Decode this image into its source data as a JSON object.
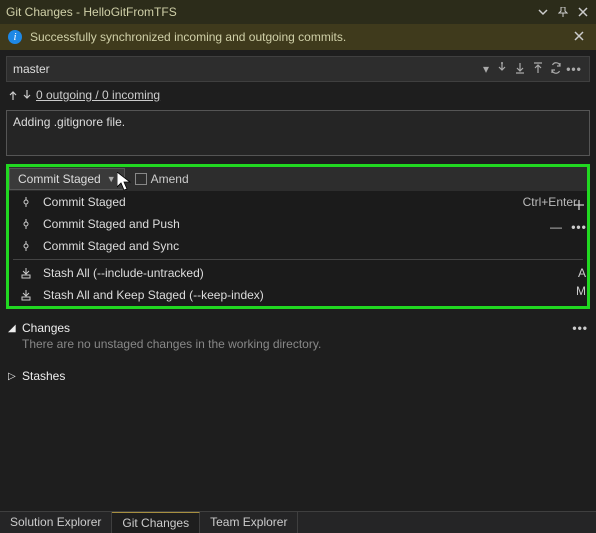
{
  "titlebar": {
    "title": "Git Changes - HelloGitFromTFS"
  },
  "notification": {
    "message": "Successfully synchronized incoming and outgoing commits."
  },
  "branch": {
    "name": "master"
  },
  "sync": {
    "link": "0 outgoing / 0 incoming"
  },
  "commit": {
    "message": "Adding .gitignore file.",
    "button_label": "Commit Staged",
    "amend_label": "Amend"
  },
  "menu": {
    "items": [
      {
        "label": "Commit Staged",
        "shortcut": "Ctrl+Enter",
        "icon": "commit"
      },
      {
        "label": "Commit Staged and Push",
        "shortcut": "",
        "icon": "commit"
      },
      {
        "label": "Commit Staged and Sync",
        "shortcut": "",
        "icon": "commit"
      }
    ],
    "stash": [
      {
        "label": "Stash All (--include-untracked)",
        "icon": "stash"
      },
      {
        "label": "Stash All and Keep Staged (--keep-index)",
        "icon": "stash"
      }
    ]
  },
  "right": {
    "a": "A",
    "m": "M"
  },
  "sections": {
    "changes": {
      "title": "Changes",
      "message": "There are no unstaged changes in the working directory."
    },
    "stashes": {
      "title": "Stashes"
    }
  },
  "tabs": {
    "solution": "Solution Explorer",
    "git": "Git Changes",
    "team": "Team Explorer"
  }
}
